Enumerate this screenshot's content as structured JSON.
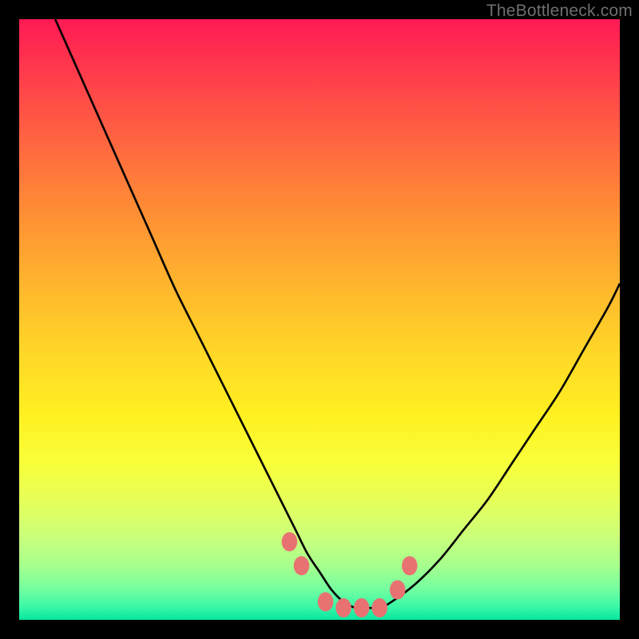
{
  "watermark": "TheBottleneck.com",
  "chart_data": {
    "type": "line",
    "title": "",
    "xlabel": "",
    "ylabel": "",
    "xlim": [
      0,
      100
    ],
    "ylim": [
      0,
      100
    ],
    "grid": false,
    "series": [
      {
        "name": "bottleneck-curve",
        "x": [
          6,
          10,
          14,
          18,
          22,
          26,
          30,
          34,
          38,
          42,
          44,
          46,
          48,
          50,
          52,
          54,
          56,
          58,
          60,
          62,
          66,
          70,
          74,
          78,
          82,
          86,
          90,
          94,
          98,
          100
        ],
        "y": [
          100,
          91,
          82,
          73,
          64,
          55,
          47,
          39,
          31,
          23,
          19,
          15,
          11,
          8,
          5,
          3,
          2,
          2,
          2,
          3,
          6,
          10,
          15,
          20,
          26,
          32,
          38,
          45,
          52,
          56
        ]
      }
    ],
    "markers": [
      {
        "name": "left-threshold-upper",
        "x": 45,
        "y": 13
      },
      {
        "name": "left-threshold-lower",
        "x": 47,
        "y": 9
      },
      {
        "name": "floor-dot-1",
        "x": 51,
        "y": 3
      },
      {
        "name": "floor-dot-2",
        "x": 54,
        "y": 2
      },
      {
        "name": "floor-dot-3",
        "x": 57,
        "y": 2
      },
      {
        "name": "floor-dot-4",
        "x": 60,
        "y": 2
      },
      {
        "name": "right-threshold-lower",
        "x": 63,
        "y": 5
      },
      {
        "name": "right-threshold-upper",
        "x": 65,
        "y": 9
      }
    ],
    "marker_color": "#e87272",
    "curve_color": "#000000"
  }
}
